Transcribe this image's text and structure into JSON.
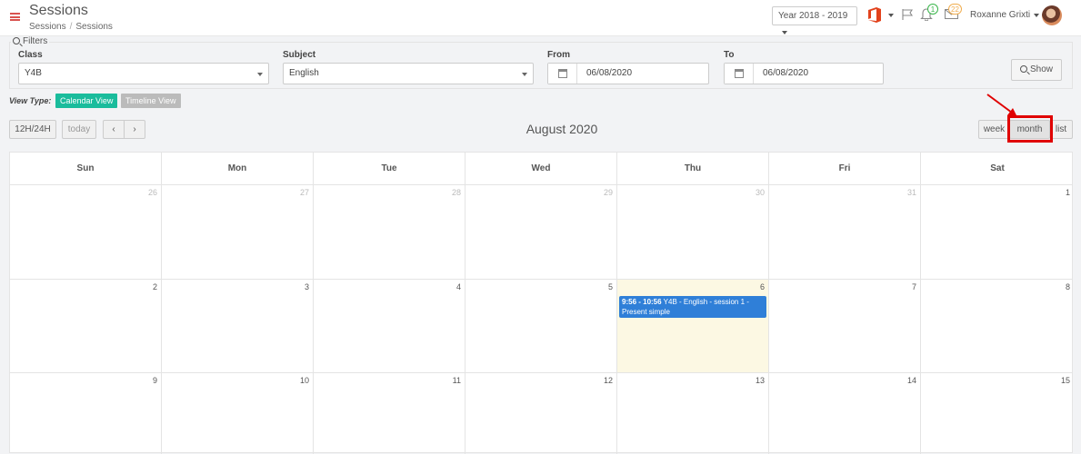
{
  "header": {
    "title": "Sessions",
    "breadcrumb": [
      "Sessions",
      "Sessions"
    ],
    "breadcrumb_sep": "/",
    "year_select": "Year 2018 - 2019",
    "user_name": "Roxanne Grixti",
    "bell_count": "1",
    "mail_count": "22",
    "icons": [
      "hamburger-icon",
      "office-icon",
      "flag-icon",
      "bell-icon",
      "mail-icon",
      "avatar"
    ]
  },
  "filters": {
    "legend": "Filters",
    "class_label": "Class",
    "class_value": "Y4B",
    "subject_label": "Subject",
    "subject_value": "English",
    "from_label": "From",
    "from_value": "06/08/2020",
    "to_label": "To",
    "to_value": "06/08/2020",
    "show_label": "Show"
  },
  "view_type": {
    "label": "View Type:",
    "calendar": "Calendar View",
    "timeline": "Timeline View"
  },
  "toolbar": {
    "h12_24": "12H/24H",
    "today": "today",
    "prev": "‹",
    "next": "›",
    "title": "August 2020",
    "week": "week",
    "month": "month",
    "list": "list"
  },
  "calendar": {
    "days_of_week": [
      "Sun",
      "Mon",
      "Tue",
      "Wed",
      "Thu",
      "Fri",
      "Sat"
    ],
    "weeks": [
      [
        "26",
        "27",
        "28",
        "29",
        "30",
        "31",
        "1"
      ],
      [
        "2",
        "3",
        "4",
        "5",
        "6",
        "7",
        "8"
      ],
      [
        "9",
        "10",
        "11",
        "12",
        "13",
        "14",
        "15"
      ]
    ],
    "event": {
      "time": "9:56 - 10:56",
      "title": "Y4B - English - session 1 - Present simple"
    }
  },
  "colors": {
    "accent_green": "#1abc9c",
    "event_blue": "#2f7fd8",
    "today_bg": "#fcf8e3",
    "highlight_red": "#e00000"
  }
}
